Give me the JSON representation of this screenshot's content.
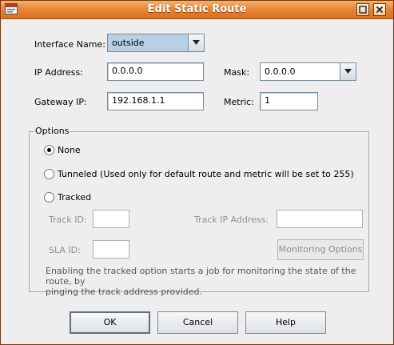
{
  "window": {
    "title": "Edit Static Route"
  },
  "form": {
    "interface_label": "Interface Name:",
    "interface_value": "outside",
    "ip_label": "IP Address:",
    "ip_value": "0.0.0.0",
    "mask_label": "Mask:",
    "mask_value": "0.0.0.0",
    "gateway_label": "Gateway IP:",
    "gateway_value": "192.168.1.1",
    "metric_label": "Metric:",
    "metric_value": "1"
  },
  "options": {
    "group_label": "Options",
    "none_label": "None",
    "tunneled_label": "Tunneled (Used only for default route and metric will be set to 255)",
    "tracked_label": "Tracked",
    "selected": "None",
    "track_id_label": "Track ID:",
    "track_ip_label": "Track IP Address:",
    "sla_id_label": "SLA ID:",
    "monitoring_button": "Monitoring Options",
    "help_line1": "Enabling the tracked option starts a job for monitoring the state of the route, by",
    "help_line2": "pinging the track address provided."
  },
  "buttons": {
    "ok": "OK",
    "cancel": "Cancel",
    "help": "Help"
  },
  "colors": {
    "titlebar": "#e8873a",
    "window_bg": "#eeeeee",
    "combo_active": "#b8cfe5"
  }
}
